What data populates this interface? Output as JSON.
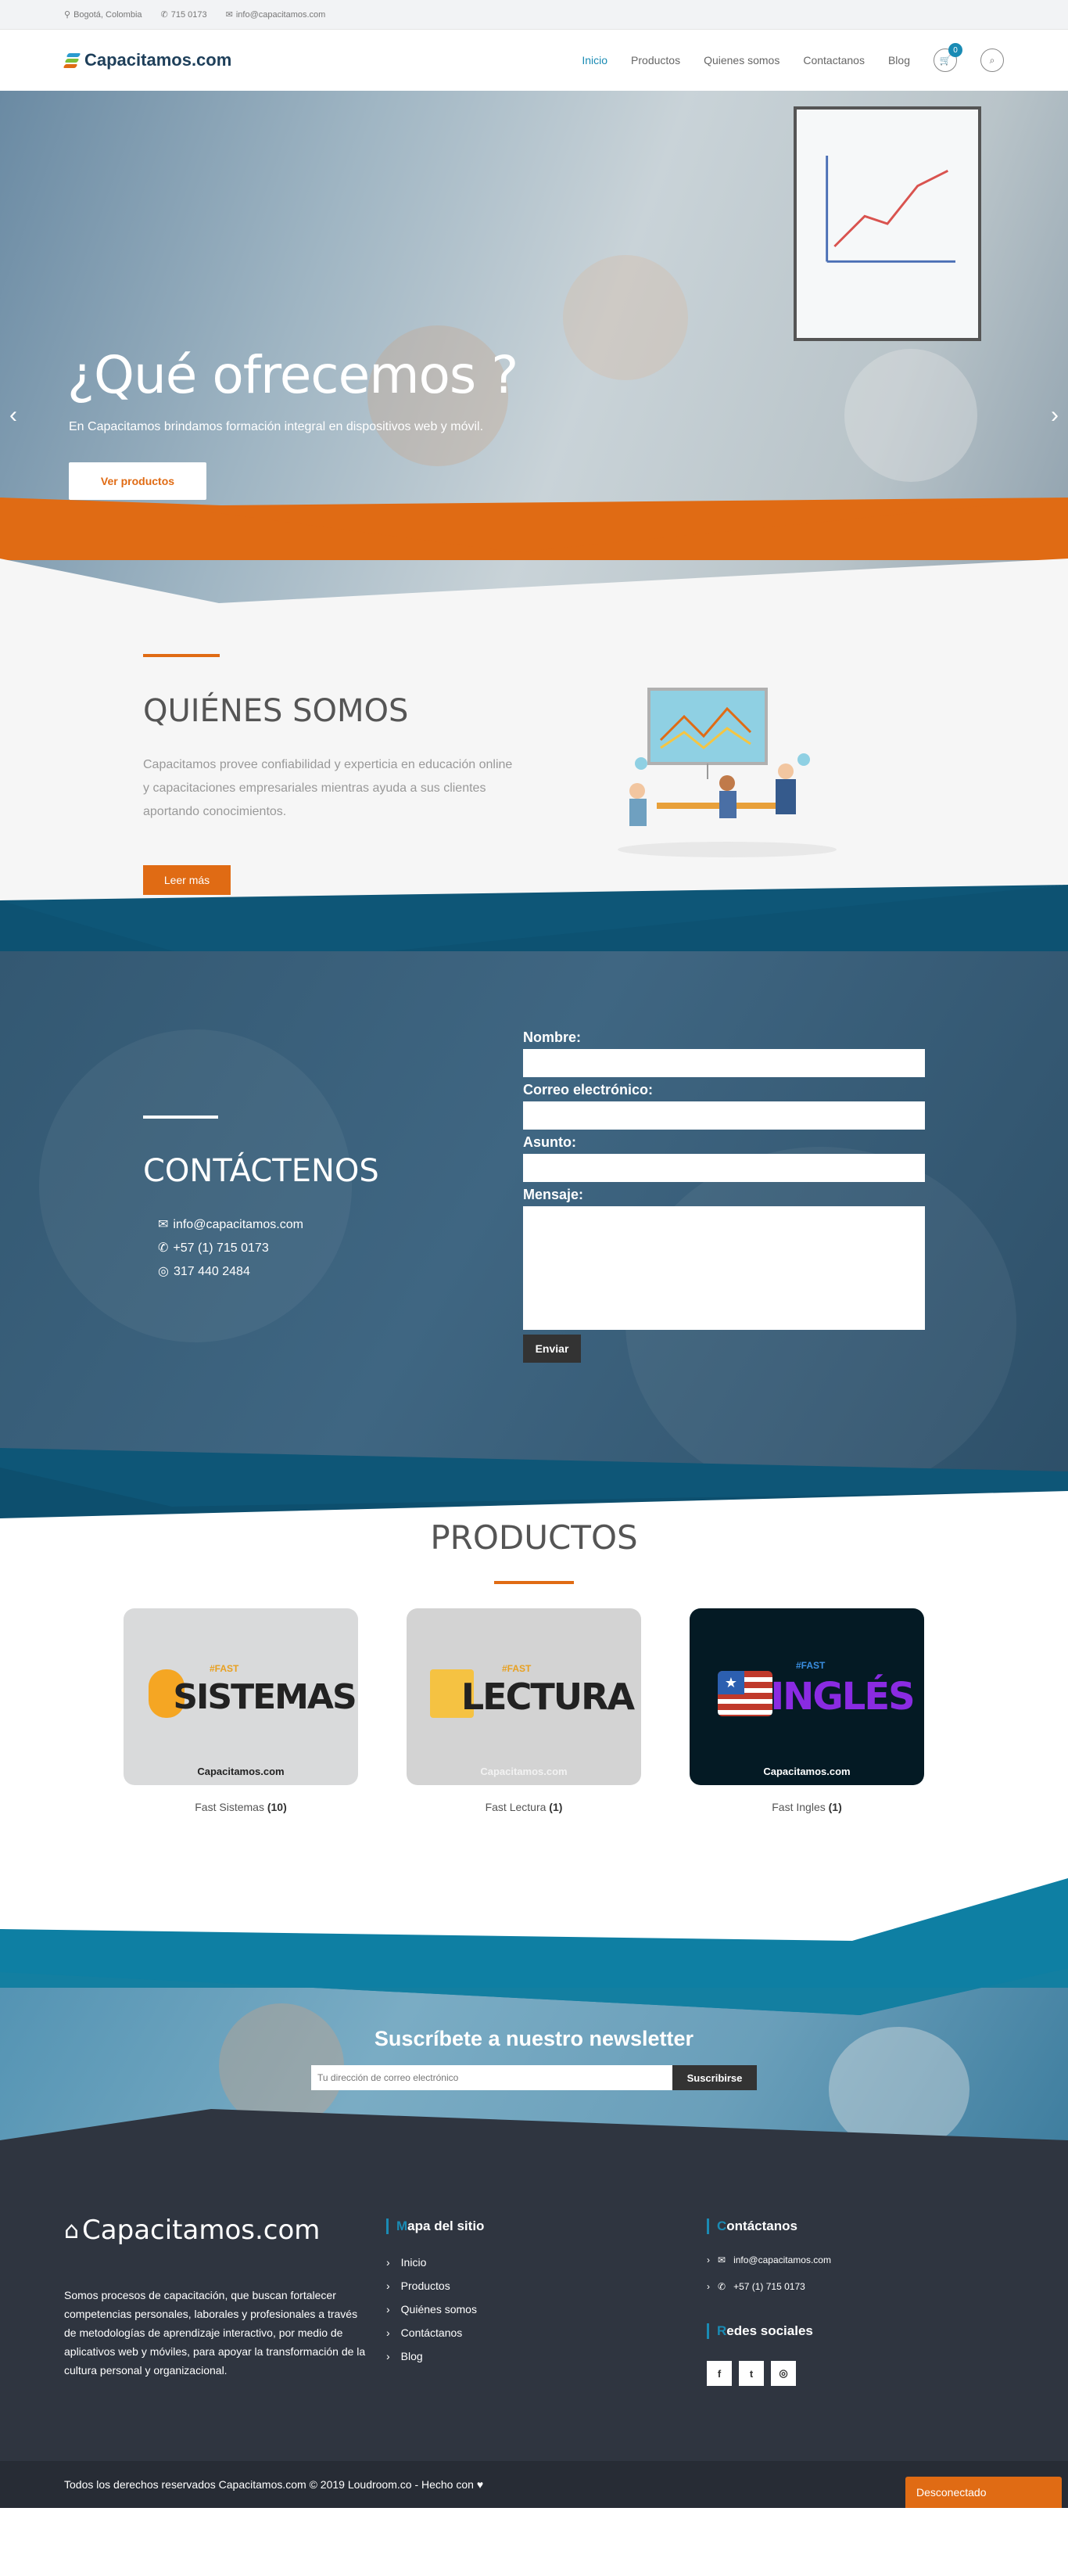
{
  "topbar": {
    "location": "Bogotá, Colombia",
    "phone": "715 0173",
    "email": "info@capacitamos.com"
  },
  "header": {
    "logo": "Capacitamos.com",
    "nav": [
      "Inicio",
      "Productos",
      "Quienes somos",
      "Contactanos",
      "Blog"
    ],
    "cart_count": "0"
  },
  "hero": {
    "title": "¿Qué ofrecemos ?",
    "subtitle": "En Capacitamos brindamos formación integral en dispositivos web y móvil.",
    "cta": "Ver productos"
  },
  "about": {
    "title": "QUIÉNES SOMOS",
    "text": "Capacitamos provee confiabilidad y experticia en educación online y capacitaciones empresariales mientras ayuda a sus clientes aportando conocimientos.",
    "button": "Leer más"
  },
  "contact": {
    "title": "CONTÁCTENOS",
    "email": "info@capacitamos.com",
    "phone": "+57 (1) 715 0173",
    "whatsapp": "317 440 2484",
    "form": {
      "name_label": "Nombre:",
      "email_label": "Correo electrónico:",
      "subject_label": "Asunto:",
      "message_label": "Mensaje:",
      "send": "Enviar"
    }
  },
  "products": {
    "title": "PRODUCTOS",
    "items": [
      {
        "fast": "#FAST",
        "word": "SISTEMAS",
        "brand": "Capacitamos.com",
        "name": "Fast Sistemas",
        "count": "(10)"
      },
      {
        "fast": "#FAST",
        "word": "LECTURA",
        "brand": "Capacitamos.com",
        "name": "Fast Lectura",
        "count": "(1)"
      },
      {
        "fast": "#FAST",
        "word": "INGLÉS",
        "brand": "Capacitamos.com",
        "name": "Fast Ingles",
        "count": "(1)"
      }
    ]
  },
  "newsletter": {
    "title": "Suscríbete a nuestro newsletter",
    "placeholder": "Tu dirección de correo electrónico",
    "button": "Suscribirse"
  },
  "footer": {
    "logo": "Capacitamos.com",
    "about": "Somos procesos de capacitación, que buscan fortalecer competencias personales, laborales y profesionales a través de metodologías de aprendizaje interactivo, por medio de aplicativos web y móviles, para apoyar la transformación de la cultura personal y organizacional.",
    "sitemap_first": "M",
    "sitemap_rest": "apa del sitio",
    "sitemap": [
      "Inicio",
      "Productos",
      "Quiénes somos",
      "Contáctanos",
      "Blog"
    ],
    "contact_first": "C",
    "contact_rest": "ontáctanos",
    "contact_email": "info@capacitamos.com",
    "contact_phone": "+57 (1) 715 0173",
    "social_first": "R",
    "social_rest": "edes sociales",
    "copyright": "Todos los derechos reservados Capacitamos.com © 2019 Loudroom.co - Hecho con",
    "offline": "Desconectado"
  },
  "colors": {
    "accent_orange": "#e06b14",
    "accent_blue": "#1a8bb4",
    "dark_blue": "#0f4f6e"
  }
}
